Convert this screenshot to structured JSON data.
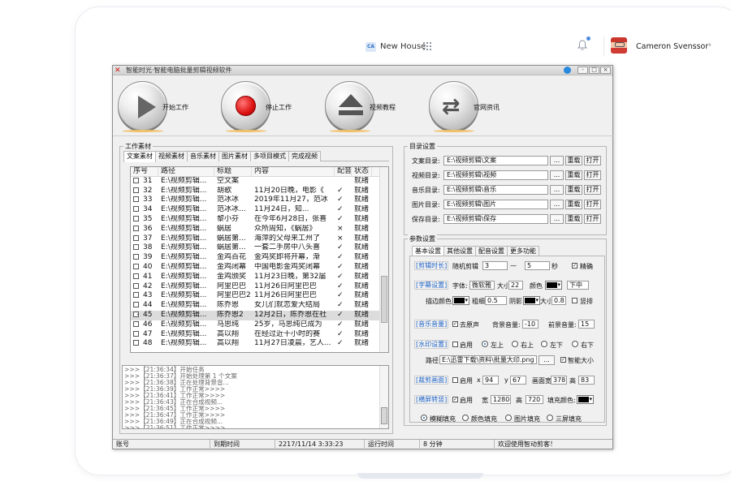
{
  "portal": {
    "project_short": "CA",
    "project_name": "New House",
    "user_name": "Cameron Svenssor",
    "chevron": "›"
  },
  "app": {
    "title": "智能时光·智能电脑批量剪辑视频软件",
    "logo": "✕",
    "controls": [
      "-",
      "□",
      "×"
    ],
    "toolbar": {
      "start": "开始工作",
      "stop": "停止工作",
      "tutorial": "视频教程",
      "news": "官网资讯"
    },
    "material_group": "工作素材",
    "material_tabs": [
      "文案素材",
      "视频素材",
      "音乐素材",
      "图片素材",
      "多项目模式",
      "完成视频"
    ],
    "table_headers": [
      "序号",
      "路径",
      "标题",
      "内容",
      "配音",
      "状态"
    ],
    "rows": [
      {
        "no": "31",
        "path": "E:\\视频剪辑...",
        "title": "空文案",
        "content": "",
        "dub": "",
        "status": "就绪",
        "selected": false
      },
      {
        "no": "32",
        "path": "E:\\视频剪辑...",
        "title": "胡歌",
        "content": "11月20日晚，电影《",
        "dub": "✓",
        "status": "就绪",
        "selected": false
      },
      {
        "no": "33",
        "path": "E:\\视频剪辑...",
        "title": "范冰冰",
        "content": "2019年11月27，范冰",
        "dub": "✓",
        "status": "就绪",
        "selected": false
      },
      {
        "no": "34",
        "path": "E:\\视频剪辑...",
        "title": "范冰冰...",
        "content": "11月24日，知...",
        "dub": "✓",
        "status": "就绪",
        "selected": false
      },
      {
        "no": "35",
        "path": "E:\\视频剪辑...",
        "title": "黎小芬",
        "content": "在今年6月28日，张喜",
        "dub": "✓",
        "status": "就绪",
        "selected": false
      },
      {
        "no": "36",
        "path": "E:\\视频剪辑...",
        "title": "蜗居",
        "content": "众所周知，《蜗居》",
        "dub": "×",
        "status": "就绪",
        "selected": false
      },
      {
        "no": "37",
        "path": "E:\\视频剪辑...",
        "title": "蜗居第...",
        "content": "海萍的父母来工州了",
        "dub": "×",
        "status": "就绪",
        "selected": false
      },
      {
        "no": "38",
        "path": "E:\\视频剪辑...",
        "title": "蜗居第...",
        "content": "一套二手房中八头喜",
        "dub": "✓",
        "status": "就绪",
        "selected": false
      },
      {
        "no": "39",
        "path": "E:\\视频剪辑...",
        "title": "金鸡百花",
        "content": "金鸡奖即将开幕，渐",
        "dub": "✓",
        "status": "就绪",
        "selected": false
      },
      {
        "no": "40",
        "path": "E:\\视频剪辑...",
        "title": "金鸡闭幕",
        "content": "中国电影金鸡奖闭幕",
        "dub": "✓",
        "status": "就绪",
        "selected": false
      },
      {
        "no": "41",
        "path": "E:\\视频剪辑...",
        "title": "金鸡颁奖",
        "content": "11月23日晚，第32届",
        "dub": "✓",
        "status": "就绪",
        "selected": false
      },
      {
        "no": "42",
        "path": "E:\\视频剪辑...",
        "title": "阿里巴巴",
        "content": "11月26日阿里巴巴",
        "dub": "✓",
        "status": "就绪",
        "selected": false
      },
      {
        "no": "43",
        "path": "E:\\视频剪辑...",
        "title": "阿里巴巴2",
        "content": "11月26日阿里巴巴",
        "dub": "✓",
        "status": "就绪",
        "selected": false
      },
      {
        "no": "44",
        "path": "E:\\视频剪辑...",
        "title": "陈乔恩",
        "content": "女儿们就恋爱大结局",
        "dub": "✓",
        "status": "就绪",
        "selected": false
      },
      {
        "no": "45",
        "path": "E:\\视频剪辑...",
        "title": "陈乔恩2",
        "content": "12月2日，陈乔恩在社",
        "dub": "✓",
        "status": "就绪",
        "selected": true
      },
      {
        "no": "46",
        "path": "E:\\视频剪辑...",
        "title": "马思纯",
        "content": "25岁，马思纯已成为",
        "dub": "✓",
        "status": "就绪",
        "selected": false
      },
      {
        "no": "47",
        "path": "E:\\视频剪辑...",
        "title": "高以翔",
        "content": "在经过近十小时的赛",
        "dub": "✓",
        "status": "就绪",
        "selected": false
      },
      {
        "no": "48",
        "path": "E:\\视频剪辑...",
        "title": "高以翔",
        "content": "11月27日凌晨，艺人...",
        "dub": "✓",
        "status": "就绪",
        "selected": false
      }
    ],
    "log_lines": [
      ">>>【21:36:34】开始任务",
      ">>>【21:36:37】开始处理第 1 个文案",
      ">>>【21:36:38】正在处理背景音...",
      ">>>【21:36:39】工作正常>>>>",
      ">>>【21:36:41】工作正常>>>>",
      ">>>【21:36:43】正在合成视频...",
      ">>>【21:36:45】工作正常>>>>",
      ">>>【21:36:47】工作正常>>>>",
      ">>>【21:36:49】正在合成视频...",
      ">>>【21:36:51】工作正常>>>>",
      ">>>【21:36:55】工作正常>>>>"
    ],
    "dir_group": "目录设置",
    "dirs": [
      {
        "label": "文案目录:",
        "value": "E:\\视频剪辑\\文案"
      },
      {
        "label": "视频目录:",
        "value": "E:\\视频剪辑\\视频"
      },
      {
        "label": "音乐目录:",
        "value": "E:\\视频剪辑\\音乐"
      },
      {
        "label": "图片目录:",
        "value": "E:\\视频剪辑\\图片"
      },
      {
        "label": "保存目录:",
        "value": "E:\\视频剪辑\\保存"
      }
    ],
    "dir_buttons": {
      "browse": "...",
      "reload": "重载",
      "open": "打开"
    },
    "param_group": "参数设置",
    "param_tabs": [
      "基本设置",
      "其他设置",
      "配音设置",
      "更多功能"
    ],
    "params": {
      "cut_time": "[剪辑时长]",
      "random_cut": "随机剪辑",
      "cut_min": "3",
      "cut_max": "5",
      "seconds": "秒",
      "precise": "精确",
      "subtitle": "[字幕设置]",
      "font_label": "字体:",
      "font_value": "微软雅",
      "size_label": "大小",
      "size_value": "22",
      "color_label": "颜色",
      "position_value": "下中",
      "stroke_color": "描边颜色:",
      "stroke_width_label": "粗细",
      "stroke_width": "0.5",
      "shadow": "阴影",
      "shadow_size_label": "大小",
      "shadow_size": "0.8",
      "vertical": "竖排",
      "music": "[音乐音量]",
      "remove_voice": "去原声",
      "bg_volume_label": "背景音量:",
      "bg_volume": "-10",
      "front_volume_label": "前景音量:",
      "front_volume": "15",
      "watermark": "[水印设置]",
      "enable": "启用",
      "top_left": "左上",
      "top_right": "右上",
      "bottom_left": "左下",
      "bottom_right": "右下",
      "path_label": "路径:",
      "watermark_path": "E:\\迅雷下载\\资料\\批量大印.png",
      "smart_size": "智能大小",
      "crop": "[裁剪画面]",
      "x_label": "x",
      "x_value": "94",
      "y_label": "y",
      "y_value": "67",
      "crop_width_label": "画面宽",
      "crop_width": "378",
      "crop_height_label": "高",
      "crop_height": "83",
      "landscape": "[横屏转竖]",
      "width_label": "宽",
      "width_value": "1280",
      "height_label": "高",
      "height_value": "720",
      "fill_color": "填充颜色:",
      "blur_fill": "模糊填充",
      "color_fill": "颜色填充",
      "image_fill": "图片填充",
      "triple_fill": "三屏填充"
    },
    "status": {
      "account_label": "账号",
      "expire_label": "到期时间",
      "expire_value": "2217/11/14 3:33:23",
      "runtime_label": "运行时间",
      "runtime_value": "8 分钟",
      "welcome": "欢迎使用智动剪客！"
    }
  }
}
